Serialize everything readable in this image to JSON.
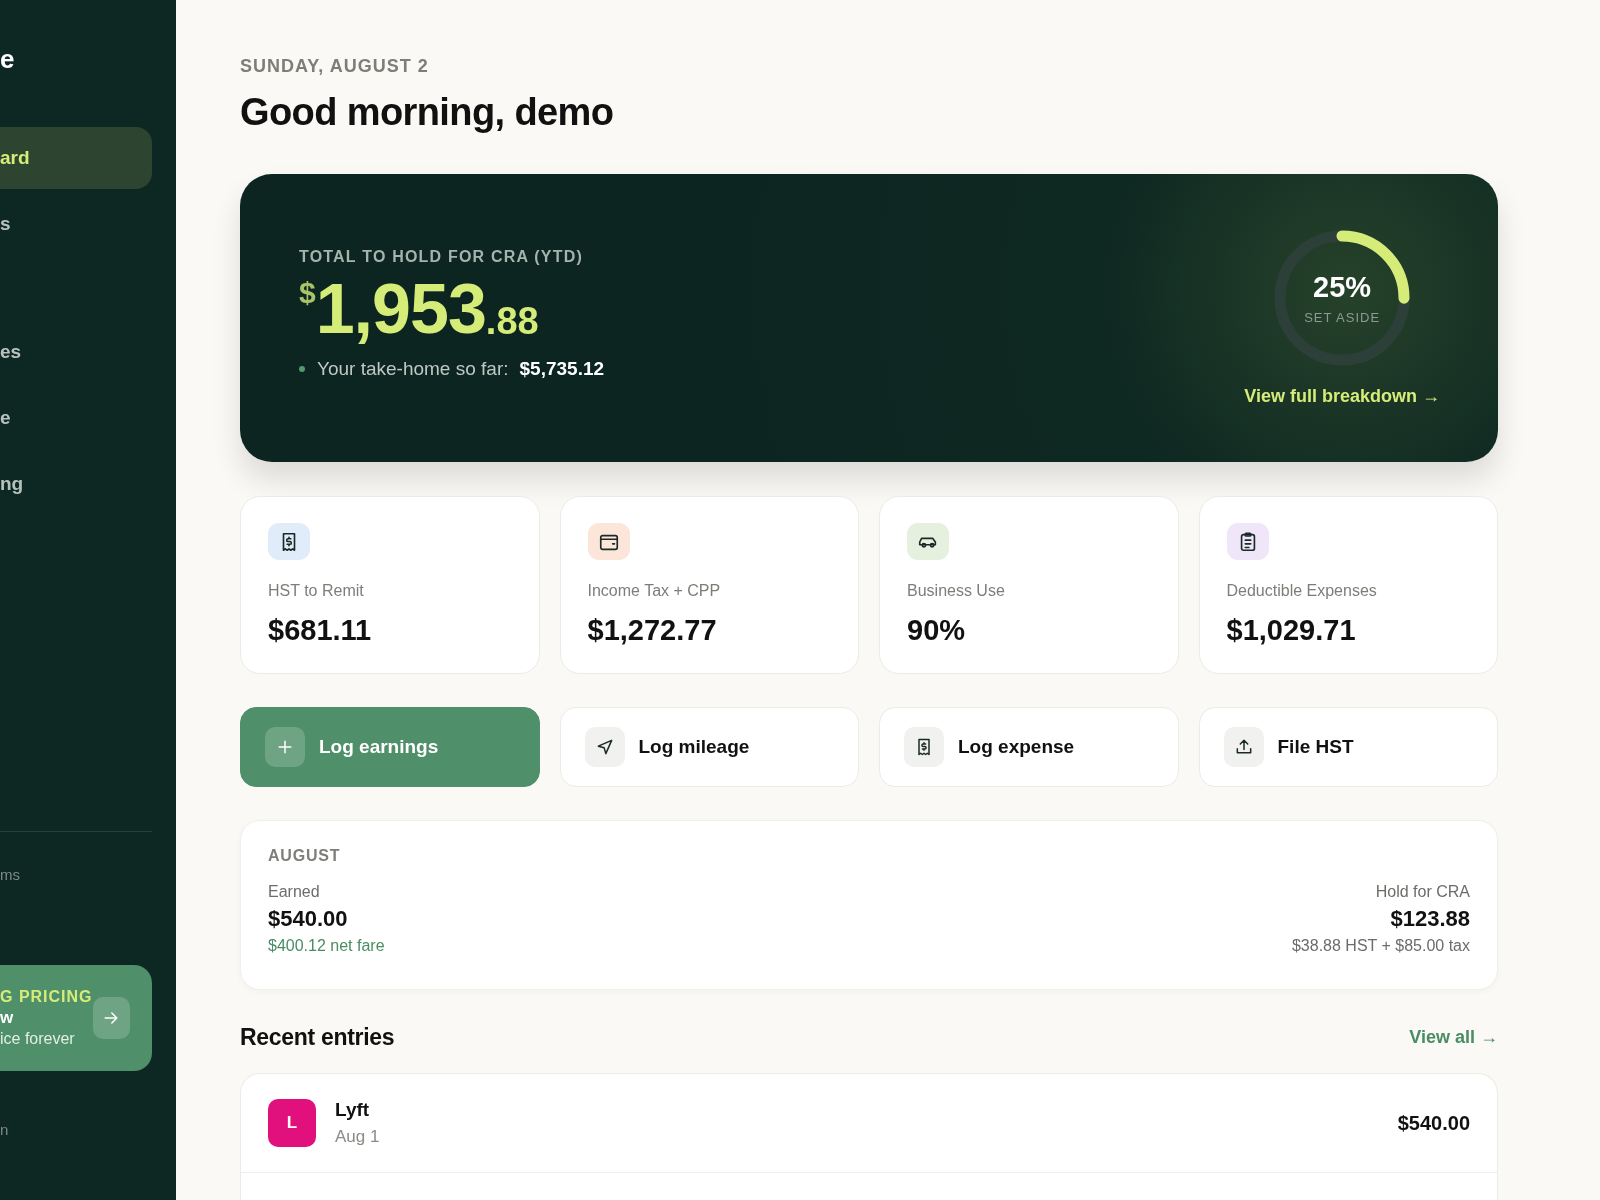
{
  "sidebar": {
    "logo": "e",
    "items": [
      {
        "label": "ard",
        "selected": true
      },
      {
        "label": "s",
        "selected": false
      },
      {
        "label": "es",
        "selected": false
      },
      {
        "label": "e",
        "selected": false
      },
      {
        "label": "ng",
        "selected": false
      }
    ],
    "footer_link": "ms",
    "promo": {
      "eyebrow": "G PRICING",
      "title": "w",
      "subtitle": "ice forever"
    },
    "bottom_link": "n"
  },
  "date": "SUNDAY, AUGUST 2",
  "greeting": "Good morning, demo",
  "hero": {
    "label": "TOTAL TO HOLD FOR CRA (YTD)",
    "currency": "$",
    "whole": "1,953",
    "cents": ".88",
    "take_home_label": "Your take-home so far:",
    "take_home": "$5,735.12",
    "ring": {
      "level": 0.25,
      "percent": "25%",
      "caption": "SET ASIDE"
    },
    "link": "View full breakdown →"
  },
  "stats": [
    {
      "kind": "receipt",
      "color": "#e1ecfb",
      "label": "HST to Remit",
      "value": "$681.11"
    },
    {
      "kind": "wallet",
      "color": "#fbe6d9",
      "label": "Income Tax + CPP",
      "value": "$1,272.77"
    },
    {
      "kind": "car",
      "color": "#e6f0df",
      "label": "Business Use",
      "value": "90%"
    },
    {
      "kind": "clipboard",
      "color": "#efe6fa",
      "label": "Deductible Expenses",
      "value": "$1,029.71"
    }
  ],
  "actions": [
    {
      "kind": "plus",
      "label": "Log earnings",
      "selected": true
    },
    {
      "kind": "navigation",
      "label": "Log mileage",
      "selected": false
    },
    {
      "kind": "receipt",
      "label": "Log expense",
      "selected": false
    },
    {
      "kind": "upload",
      "label": "File HST",
      "selected": false
    }
  ],
  "month": {
    "title": "AUGUST",
    "earned_label": "Earned",
    "earned": "$540.00",
    "net": "$400.12 net fare",
    "hold_label": "Hold for CRA",
    "hold": "$123.88",
    "hold_detail": "$38.88 HST + $85.00 tax"
  },
  "recent": {
    "title": "Recent entries",
    "link": "View all →",
    "entries": [
      {
        "initial": "L",
        "color": "#e2107c",
        "name": "Lyft",
        "date": "Aug 1",
        "amount": "$540.00"
      }
    ]
  }
}
